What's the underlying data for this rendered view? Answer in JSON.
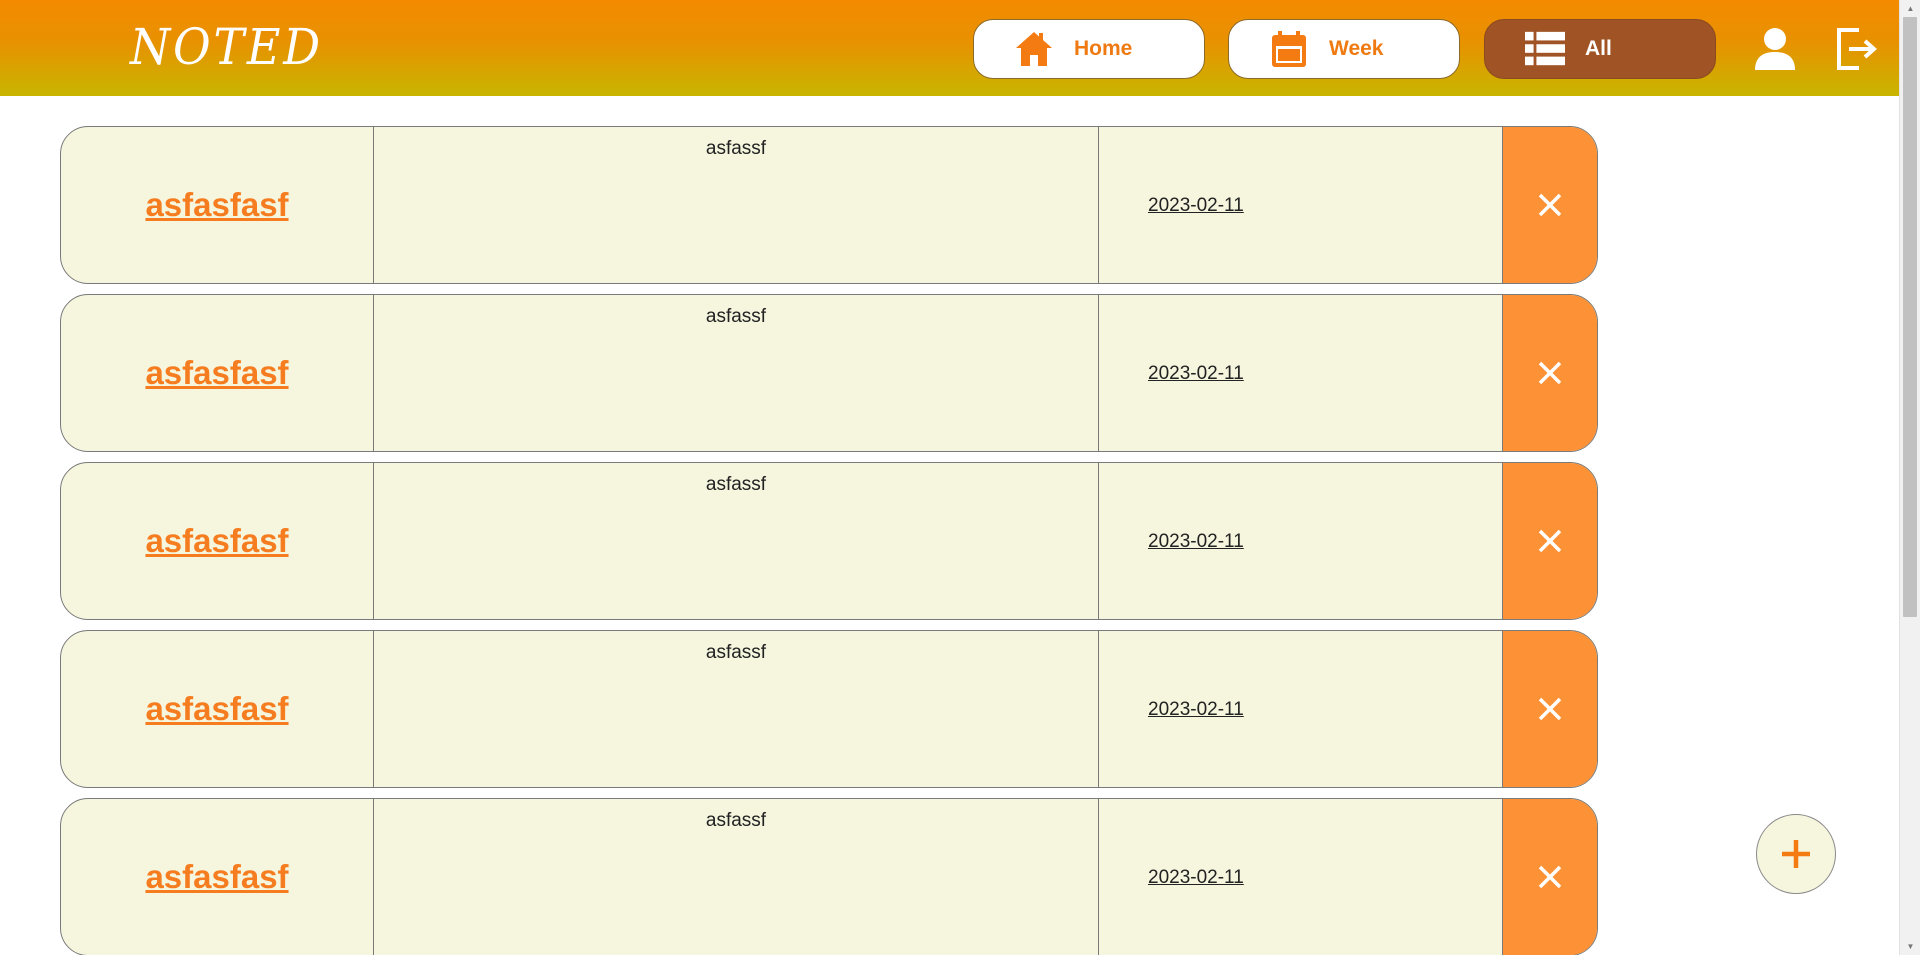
{
  "app": {
    "logo": "NOTED"
  },
  "nav": {
    "home": {
      "label": "Home",
      "icon": "home-icon"
    },
    "week": {
      "label": "Week",
      "icon": "calendar-icon"
    },
    "all": {
      "label": "All",
      "icon": "list-icon",
      "active": true
    },
    "user_icon": "user-icon",
    "logout_icon": "logout-icon"
  },
  "notes": [
    {
      "title": "asfasfasf",
      "body": "asfassf",
      "date": "2023-02-11"
    },
    {
      "title": "asfasfasf",
      "body": "asfassf",
      "date": "2023-02-11"
    },
    {
      "title": "asfasfasf",
      "body": "asfassf",
      "date": "2023-02-11"
    },
    {
      "title": "asfasfasf",
      "body": "asfassf",
      "date": "2023-02-11"
    },
    {
      "title": "asfasfasf",
      "body": "asfassf",
      "date": "2023-02-11"
    }
  ],
  "add_button": {
    "icon": "plus-icon"
  },
  "colors": {
    "header_top": "#f48a00",
    "header_bottom": "#c8b500",
    "accent": "#f57d1f",
    "active_nav": "#a05425",
    "note_bg": "#f6f5de",
    "delete_bg": "#fd9136"
  }
}
